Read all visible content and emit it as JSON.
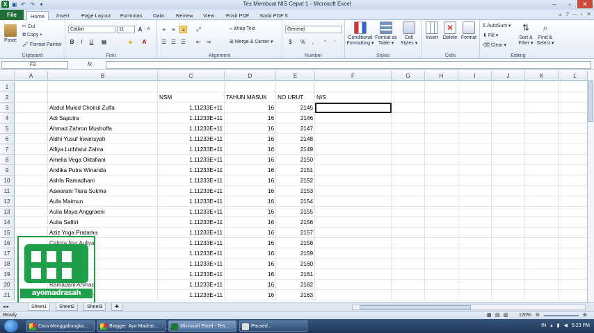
{
  "window": {
    "title": "Tes Membuat NIS Cepat 1  -  Microsoft Excel",
    "min": "–",
    "max": "▫",
    "close": "✕"
  },
  "tabs": [
    "Home",
    "Insert",
    "Page Layout",
    "Formulas",
    "Data",
    "Review",
    "View",
    "Foxit PDF",
    "Soda PDF 5"
  ],
  "file_tab": "File",
  "ribbon": {
    "clipboard": {
      "label": "Clipboard",
      "paste": "Paste",
      "cut": "Cut",
      "copy": "Copy ▾",
      "format_painter": "Format Painter"
    },
    "font": {
      "label": "Font",
      "name": "Calibri",
      "size": "11",
      "grow": "A",
      "shrink": "A",
      "bold": "B",
      "italic": "I",
      "underline": "U"
    },
    "alignment": {
      "label": "Alignment",
      "wrap": "Wrap Text",
      "merge": "Merge & Center ▾"
    },
    "number": {
      "label": "Number",
      "format": "General",
      "currency": "$",
      "percent": "%",
      "comma": ","
    },
    "styles": {
      "label": "Styles",
      "conditional": "Conditional Formatting ▾",
      "format_table": "Format as Table ▾",
      "cell_styles": "Cell Styles ▾"
    },
    "cells": {
      "label": "Cells",
      "insert": "Insert",
      "delete": "Delete",
      "format": "Format"
    },
    "editing": {
      "label": "Editing",
      "autosum": "AutoSum ▾",
      "fill": "Fill ▾",
      "clear": "Clear ▾",
      "sort": "Sort & Filter ▾",
      "find": "Find & Select ▾"
    }
  },
  "formula_bar": {
    "name_box": "F3",
    "fx": "fx",
    "value": ""
  },
  "columns": [
    "A",
    "B",
    "C",
    "D",
    "E",
    "F",
    "G",
    "H",
    "I",
    "J",
    "K",
    "L"
  ],
  "rows": [
    {
      "n": "1",
      "b": "",
      "c": "",
      "d": "",
      "e": "",
      "f": ""
    },
    {
      "n": "2",
      "b": "",
      "c": "NSM",
      "d": "TAHUN MASUK",
      "e": "NO URUT",
      "f": "NIS"
    },
    {
      "n": "3",
      "b": "Abdul Mukid Choirul Zulfa",
      "c": "1.11233E+11",
      "d": "16",
      "e": "2145",
      "f": ""
    },
    {
      "n": "4",
      "b": "Adi Saputra",
      "c": "1.11233E+11",
      "d": "16",
      "e": "2146",
      "f": ""
    },
    {
      "n": "5",
      "b": "Ahmad Zahron Mushoffa",
      "c": "1.11233E+11",
      "d": "16",
      "e": "2147",
      "f": ""
    },
    {
      "n": "6",
      "b": "Aldhi Yusuf Irwansyah",
      "c": "1.11233E+11",
      "d": "16",
      "e": "2148",
      "f": ""
    },
    {
      "n": "7",
      "b": "Alfiya Luthfatul Zahra",
      "c": "1.11233E+11",
      "d": "16",
      "e": "2149",
      "f": ""
    },
    {
      "n": "8",
      "b": "Amelia Vega Oktafiani",
      "c": "1.11233E+11",
      "d": "16",
      "e": "2150",
      "f": ""
    },
    {
      "n": "9",
      "b": "Andika Putra Winanda",
      "c": "1.11233E+11",
      "d": "16",
      "e": "2151",
      "f": ""
    },
    {
      "n": "10",
      "b": "Ashfa Ramadhani",
      "c": "1.11233E+11",
      "d": "16",
      "e": "2152",
      "f": ""
    },
    {
      "n": "11",
      "b": "Aswarani Tiara Sukma",
      "c": "1.11233E+11",
      "d": "16",
      "e": "2153",
      "f": ""
    },
    {
      "n": "12",
      "b": "Aufa Maimun",
      "c": "1.11233E+11",
      "d": "16",
      "e": "2154",
      "f": ""
    },
    {
      "n": "13",
      "b": "Aulia Maya Anggraeni",
      "c": "1.11233E+11",
      "d": "16",
      "e": "2155",
      "f": ""
    },
    {
      "n": "14",
      "b": "Aulia Safitri",
      "c": "1.11233E+11",
      "d": "16",
      "e": "2156",
      "f": ""
    },
    {
      "n": "15",
      "b": "Aziz Yoga Pratama",
      "c": "1.11233E+11",
      "d": "16",
      "e": "2157",
      "f": ""
    },
    {
      "n": "16",
      "b": "Calista Nur Auliya",
      "c": "1.11233E+11",
      "d": "16",
      "e": "2158",
      "f": ""
    },
    {
      "n": "17",
      "b": "a Andara",
      "c": "1.11233E+11",
      "d": "16",
      "e": "2159",
      "f": ""
    },
    {
      "n": "18",
      "b": "utri Ardiani",
      "c": "1.11233E+11",
      "d": "16",
      "e": "2160",
      "f": ""
    },
    {
      "n": "19",
      "b": "u Prahesti",
      "c": "1.11233E+11",
      "d": "16",
      "e": "2161",
      "f": ""
    },
    {
      "n": "20",
      "b": "Ramadani Ahmad",
      "c": "1.11233E+11",
      "d": "16",
      "e": "2162",
      "f": ""
    },
    {
      "n": "21",
      "b": "Laturatun Naimah",
      "c": "1.11233E+11",
      "d": "16",
      "e": "2163",
      "f": ""
    }
  ],
  "sheets": [
    "Sheet1",
    "Sheet2",
    "Sheet3"
  ],
  "status": {
    "ready": "Ready",
    "zoom": "120%"
  },
  "watermark": {
    "text": "ayomadrasah"
  },
  "taskbar": {
    "items": [
      "Cara Menggabungka...",
      "Blogger: Ayo Madras...",
      "Microsoft Excel - Tes...",
      "Paused..."
    ],
    "lang": "IN",
    "time": "5:23 PM"
  }
}
